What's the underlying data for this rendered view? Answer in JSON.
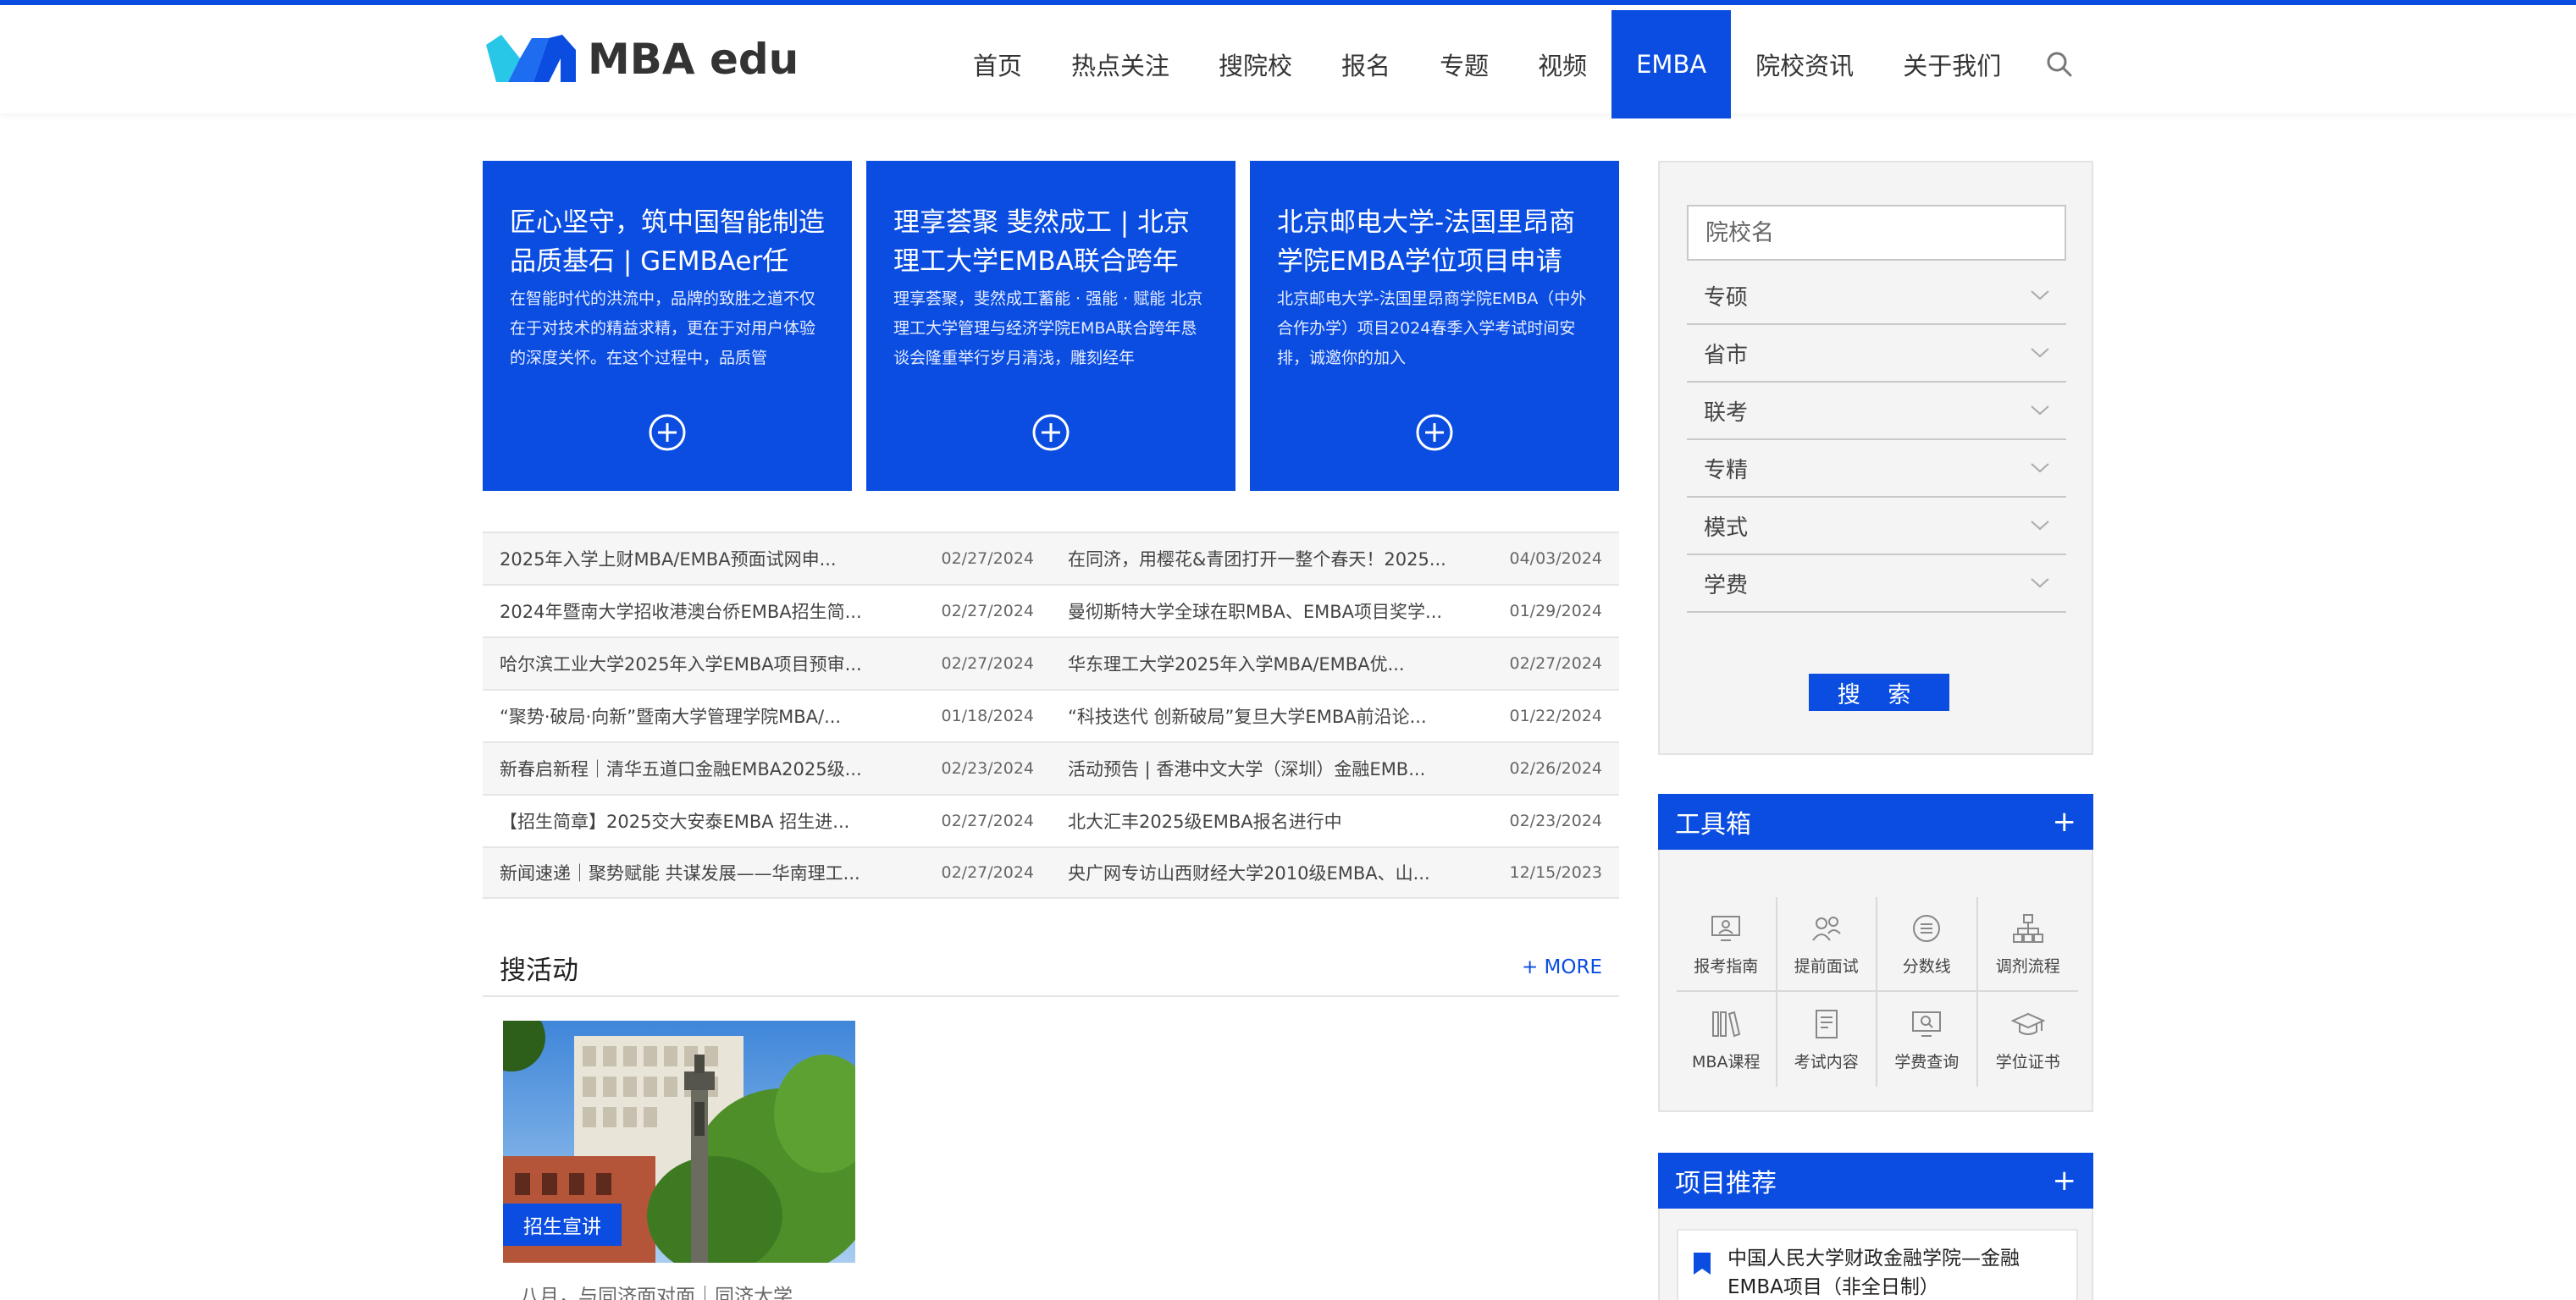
{
  "brand": {
    "name": "MBA edu",
    "primary_color": "#0a4de0"
  },
  "nav": {
    "items": [
      "首页",
      "热点关注",
      "搜院校",
      "报名",
      "专题",
      "视频",
      "EMBA",
      "院校资讯",
      "关于我们"
    ],
    "active": "EMBA"
  },
  "feature_cards": [
    {
      "title": "匠心坚守，筑中国智能制造品质基石 | GEMBAer任",
      "desc": "在智能时代的洪流中，品牌的致胜之道不仅在于对技术的精益求精，更在于对用户体验的深度关怀。在这个过程中，品质管"
    },
    {
      "title": "理享荟聚 斐然成工 | 北京理工大学EMBA联合跨年",
      "desc": "理享荟聚，斐然成工蓄能 · 强能 · 赋能 北京理工大学管理与经济学院EMBA联合跨年恳谈会隆重举行岁月清浅，雕刻经年"
    },
    {
      "title": "北京邮电大学-法国里昂商学院EMBA学位项目申请",
      "desc": "北京邮电大学-法国里昂商学院EMBA（中外合作办学）项目2024春季入学考试时间安排，诚邀你的加入"
    }
  ],
  "news": [
    [
      {
        "title": "2025年入学上财MBA/EMBA预面试网申...",
        "date": "02/27/2024"
      },
      {
        "title": "在同济，用樱花&青团打开一整个春天！2025...",
        "date": "04/03/2024"
      }
    ],
    [
      {
        "title": "2024年暨南大学招收港澳台侨EMBA招生简...",
        "date": "02/27/2024"
      },
      {
        "title": "曼彻斯特大学全球在职MBA、EMBA项目奖学...",
        "date": "01/29/2024"
      }
    ],
    [
      {
        "title": "哈尔滨工业大学2025年入学EMBA项目预审...",
        "date": "02/27/2024"
      },
      {
        "title": "华东理工大学2025年入学MBA/EMBA优...",
        "date": "02/27/2024"
      }
    ],
    [
      {
        "title": "“聚势·破局·向新”暨南大学管理学院MBA/...",
        "date": "01/18/2024"
      },
      {
        "title": "“科技迭代 创新破局”复旦大学EMBA前沿论...",
        "date": "01/22/2024"
      }
    ],
    [
      {
        "title": "新春启新程｜清华五道口金融EMBA2025级...",
        "date": "02/23/2024"
      },
      {
        "title": "活动预告 | 香港中文大学（深圳）金融EMB...",
        "date": "02/26/2024"
      }
    ],
    [
      {
        "title": "【招生简章】2025交大安泰EMBA 招生进...",
        "date": "02/27/2024"
      },
      {
        "title": "北大汇丰2025级EMBA报名进行中",
        "date": "02/23/2024"
      }
    ],
    [
      {
        "title": "新闻速递｜聚势赋能 共谋发展——华南理工...",
        "date": "02/27/2024"
      },
      {
        "title": "央广网专访山西财经大学2010级EMBA、山...",
        "date": "12/15/2023"
      }
    ]
  ],
  "activity": {
    "heading": "搜活动",
    "more": "+ MORE",
    "card": {
      "tag": "招生宣讲",
      "caption": "八月，与同济面对面｜同济大学"
    }
  },
  "filter": {
    "placeholder": "院校名",
    "options": [
      "专硕",
      "省市",
      "联考",
      "专精",
      "模式",
      "学费"
    ],
    "button": "搜 索"
  },
  "toolbox": {
    "heading": "工具箱",
    "plus": "+",
    "tools": [
      {
        "label": "报考指南",
        "icon": "monitor-user-icon"
      },
      {
        "label": "提前面试",
        "icon": "interview-icon"
      },
      {
        "label": "分数线",
        "icon": "list-circle-icon"
      },
      {
        "label": "调剂流程",
        "icon": "flowchart-icon"
      },
      {
        "label": "MBA课程",
        "icon": "books-icon"
      },
      {
        "label": "考试内容",
        "icon": "document-icon"
      },
      {
        "label": "学费查询",
        "icon": "monitor-search-icon"
      },
      {
        "label": "学位证书",
        "icon": "graduation-cap-icon"
      }
    ]
  },
  "recommend": {
    "heading": "项目推荐",
    "plus": "+",
    "items": [
      "中国人民大学财政金融学院—金融EMBA项目（非全日制）"
    ]
  }
}
